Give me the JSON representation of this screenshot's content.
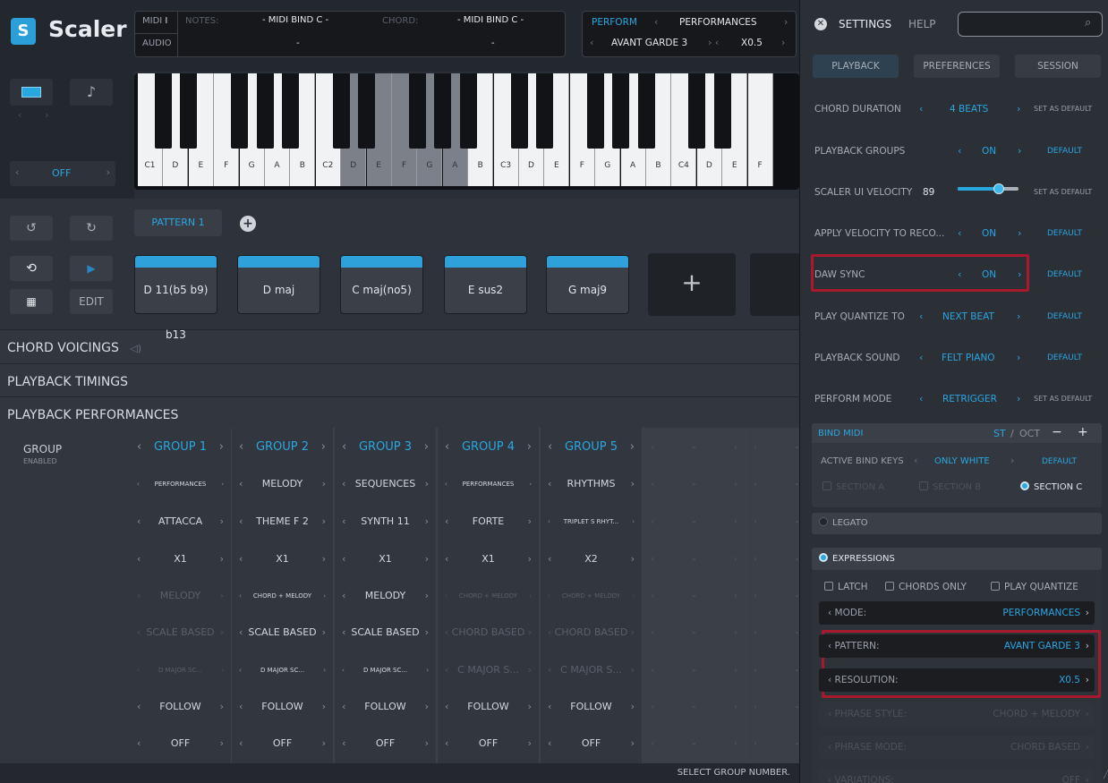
{
  "app": {
    "name": "Scaler",
    "logo_glyph": "S"
  },
  "io": {
    "midi_tab": "MIDI",
    "audio_tab": "AUDIO",
    "notes_label": "NOTES:",
    "notes_value": "- MIDI BIND C -",
    "notes_sub": "-",
    "chord_label": "CHORD:",
    "chord_value": "- MIDI BIND C -",
    "chord_sub": "-"
  },
  "perform": {
    "tab": "PERFORM",
    "mode": "PERFORMANCES",
    "pattern": "AVANT GARDE 3",
    "resolution": "X0.5"
  },
  "left_tools": {
    "octave_value": "OFF",
    "edit_label": "EDIT"
  },
  "keyboard": {
    "white_keys": [
      "C1",
      "D",
      "E",
      "F",
      "G",
      "A",
      "B",
      "C2",
      "D",
      "E",
      "F",
      "G",
      "A",
      "B",
      "C3",
      "D",
      "E",
      "F",
      "G",
      "A",
      "B",
      "C4",
      "D",
      "E",
      "F"
    ]
  },
  "pattern": {
    "tab": "PATTERN 1",
    "add_glyph": "+"
  },
  "chords": [
    "D 11(b5 b9) b13",
    "D maj",
    "C maj(no5)",
    "E sus2",
    "G maj9"
  ],
  "sections": {
    "voicings": "CHORD VOICINGS",
    "timings": "PLAYBACK TIMINGS",
    "performances": "PLAYBACK PERFORMANCES"
  },
  "group_panel": {
    "title": "GROUP",
    "subtitle": "ENABLED"
  },
  "groups": [
    {
      "name": "GROUP 1",
      "cells": [
        "PERFORMANCES",
        "ATTACCA",
        "X1",
        "MELODY",
        "SCALE BASED",
        "D MAJOR SC...",
        "FOLLOW",
        "OFF"
      ]
    },
    {
      "name": "GROUP 2",
      "cells": [
        "MELODY",
        "THEME F 2",
        "X1",
        "CHORD + MELODY",
        "SCALE BASED",
        "D MAJOR SC...",
        "FOLLOW",
        "OFF"
      ]
    },
    {
      "name": "GROUP 3",
      "cells": [
        "SEQUENCES",
        "SYNTH 11",
        "X1",
        "MELODY",
        "SCALE BASED",
        "D MAJOR SC...",
        "FOLLOW",
        "OFF"
      ]
    },
    {
      "name": "GROUP 4",
      "cells": [
        "PERFORMANCES",
        "FORTE",
        "X1",
        "CHORD + MELODY",
        "CHORD BASED",
        "C MAJOR S...",
        "FOLLOW",
        "OFF"
      ]
    },
    {
      "name": "GROUP 5",
      "cells": [
        "RHYTHMS",
        "TRIPLET S RHYT...",
        "X2",
        "CHORD + MELODY",
        "CHORD BASED",
        "C MAJOR S...",
        "FOLLOW",
        "OFF"
      ]
    }
  ],
  "footer": {
    "text": "SELECT GROUP NUMBER."
  },
  "settings": {
    "title": "SETTINGS",
    "help": "HELP",
    "search_placeholder": "",
    "tabs": [
      "PLAYBACK",
      "PREFERENCES",
      "SESSION"
    ],
    "rows": [
      {
        "label": "CHORD DURATION",
        "value": "4 BEATS",
        "default": "SET AS DEFAULT"
      },
      {
        "label": "PLAYBACK GROUPS",
        "value": "ON",
        "default": "DEFAULT"
      },
      {
        "label": "SCALER UI VELOCITY",
        "value": "89",
        "default": "SET AS DEFAULT"
      },
      {
        "label": "APPLY VELOCITY TO RECO...",
        "value": "ON",
        "default": "DEFAULT"
      },
      {
        "label": "DAW SYNC",
        "value": "ON",
        "default": "DEFAULT"
      },
      {
        "label": "PLAY QUANTIZE TO",
        "value": "NEXT BEAT",
        "default": "DEFAULT"
      },
      {
        "label": "PLAYBACK SOUND",
        "value": "FELT PIANO",
        "default": "DEFAULT"
      },
      {
        "label": "PERFORM MODE",
        "value": "RETRIGGER",
        "default": "SET AS DEFAULT"
      }
    ],
    "velocity_fraction": 0.68,
    "bind_midi": {
      "title": "BIND MIDI",
      "st": "ST",
      "sep": "/",
      "oct": "OCT",
      "minus": "−",
      "plus": "+",
      "active_label": "ACTIVE BIND KEYS",
      "active_value": "ONLY WHITE",
      "active_default": "DEFAULT",
      "section_a": "SECTION A",
      "section_b": "SECTION B",
      "section_c": "SECTION C"
    },
    "legato": "LEGATO",
    "expressions": {
      "title": "EXPRESSIONS",
      "latch": "LATCH",
      "chords_only": "CHORDS ONLY",
      "play_quantize": "PLAY QUANTIZE",
      "rows": [
        {
          "key": "MODE:",
          "value": "PERFORMANCES"
        },
        {
          "key": "PATTERN:",
          "value": "AVANT GARDE 3"
        },
        {
          "key": "RESOLUTION:",
          "value": "X0.5"
        },
        {
          "key": "PHRASE STYLE:",
          "value": "CHORD + MELODY"
        },
        {
          "key": "PHRASE MODE:",
          "value": "CHORD BASED"
        },
        {
          "key": "VARIATIONS:",
          "value": "OFF"
        }
      ]
    }
  },
  "colors": {
    "accent": "#29a8e0",
    "highlight": "#a8192e",
    "panel": "#2b2f36"
  }
}
